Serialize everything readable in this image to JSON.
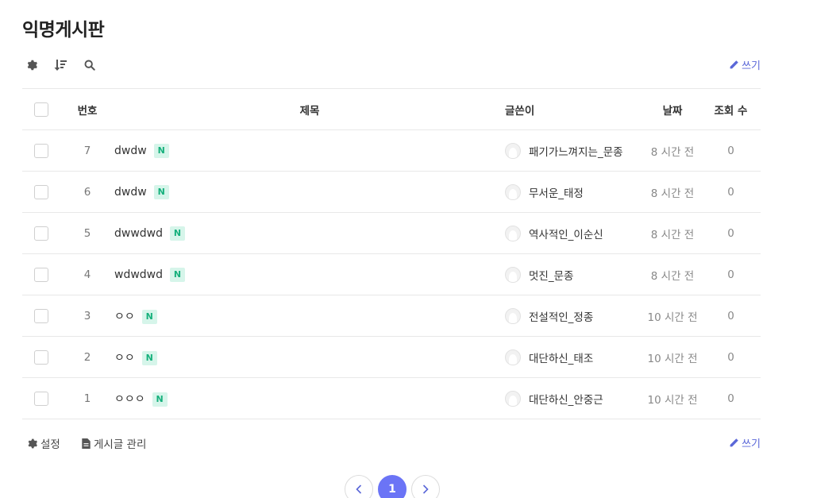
{
  "board": {
    "title": "익명게시판",
    "write_label": "쓰기",
    "icons": {
      "settings": "gear-icon",
      "sort": "sort-icon",
      "search": "search-icon",
      "write": "pencil-icon"
    },
    "accent_color": "#6b74f6",
    "badge_color": "#16b07c"
  },
  "table": {
    "headers": {
      "number": "번호",
      "title": "제목",
      "writer": "글쓴이",
      "date": "날짜",
      "views": "조회 수"
    },
    "rows": [
      {
        "number": "7",
        "title": "dwdw",
        "badge": "N",
        "writer": "패기가느껴지는_문종",
        "date": "8 시간 전",
        "views": "0"
      },
      {
        "number": "6",
        "title": "dwdw",
        "badge": "N",
        "writer": "무서운_태정",
        "date": "8 시간 전",
        "views": "0"
      },
      {
        "number": "5",
        "title": "dwwdwd",
        "badge": "N",
        "writer": "역사적인_이순신",
        "date": "8 시간 전",
        "views": "0"
      },
      {
        "number": "4",
        "title": "wdwdwd",
        "badge": "N",
        "writer": "멋진_문종",
        "date": "8 시간 전",
        "views": "0"
      },
      {
        "number": "3",
        "title": "ㅇㅇ",
        "badge": "N",
        "writer": "전설적인_정종",
        "date": "10 시간 전",
        "views": "0"
      },
      {
        "number": "2",
        "title": "ㅇㅇ",
        "badge": "N",
        "writer": "대단하신_태조",
        "date": "10 시간 전",
        "views": "0"
      },
      {
        "number": "1",
        "title": "ㅇㅇㅇ",
        "badge": "N",
        "writer": "대단하신_안중근",
        "date": "10 시간 전",
        "views": "0"
      }
    ]
  },
  "footer": {
    "settings_label": "설정",
    "manage_label": "게시글 관리",
    "write_label": "쓰기"
  },
  "pagination": {
    "current_page": "1",
    "prev_icon": "chevron-left-icon",
    "next_icon": "chevron-right-icon"
  }
}
